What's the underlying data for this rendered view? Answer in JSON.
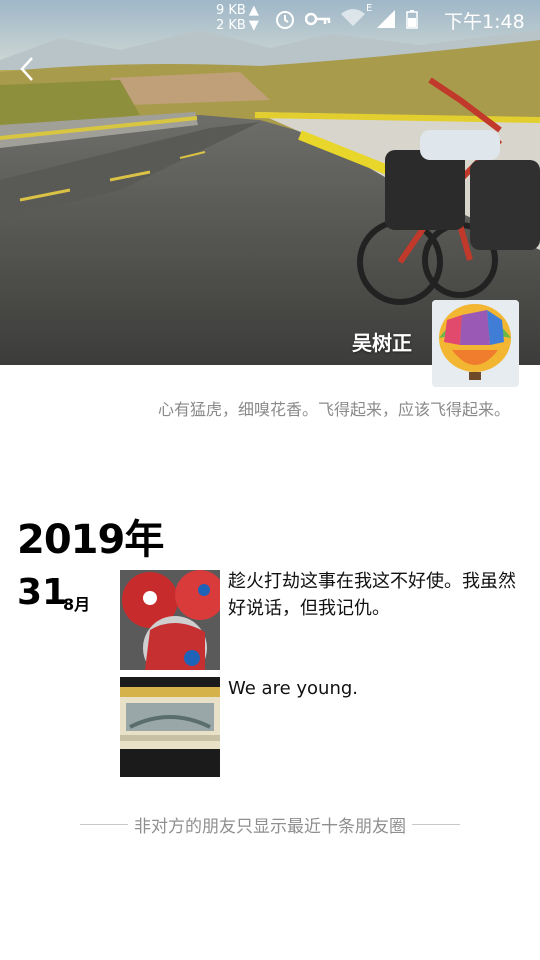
{
  "status_bar": {
    "up_speed": "9 KB",
    "down_speed": "2 KB",
    "time": "下午1:48",
    "icons": [
      "alarm-icon",
      "vpn-key-icon",
      "wifi-icon",
      "mobile-signal-icon",
      "battery-icon"
    ],
    "network_type": "E"
  },
  "header": {
    "back_icon": "chevron-left-icon"
  },
  "profile": {
    "name": "吴树正",
    "signature": "心有猛虎，细嗅花香。飞得起来，应该飞得起来。"
  },
  "timeline": {
    "year": "2019年",
    "day": "31",
    "month": "8月",
    "posts": [
      {
        "text": "趁火打劫这事在我这不好使。我虽然好说话，但我记仇。"
      },
      {
        "text": "We are young."
      }
    ]
  },
  "footer": {
    "notice": "非对方的朋友只显示最近十条朋友圈"
  }
}
